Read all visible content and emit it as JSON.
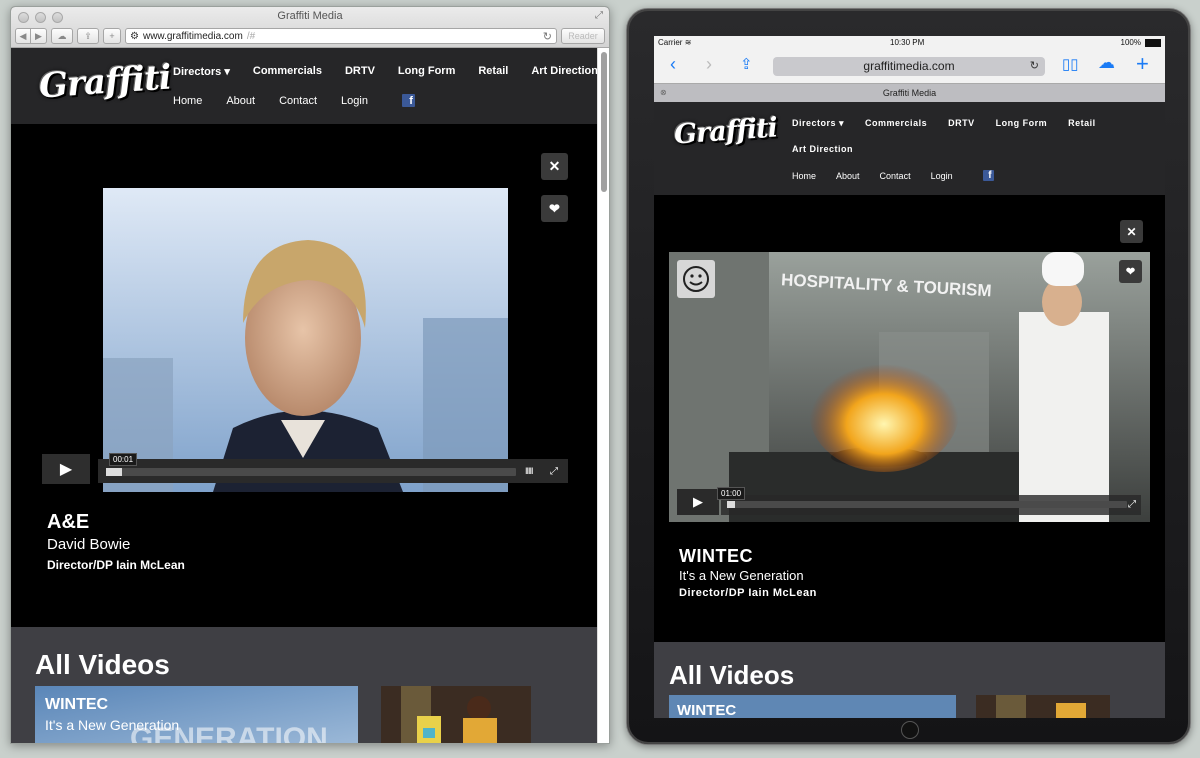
{
  "desktop": {
    "window_title": "Graffiti Media",
    "url": "www.graffitimedia.com",
    "url_hash": "/#",
    "reader_label": "Reader",
    "logo_text": "Graffiti",
    "nav_primary": [
      "Directors ▾",
      "Commercials",
      "DRTV",
      "Long Form",
      "Retail",
      "Art Direction"
    ],
    "nav_secondary": [
      "Home",
      "About",
      "Contact",
      "Login"
    ],
    "facebook_icon": "f",
    "close_icon": "✕",
    "heart_icon": "❤",
    "play_icon": "▶",
    "time_label": "00:01",
    "progress": 0.04,
    "volume_icon": "IIIII",
    "fullscreen_icon": "⤢",
    "caption": {
      "title": "A&E",
      "subtitle": "David Bowie",
      "director": "Director/DP Iain McLean"
    },
    "all_videos_heading": "All Videos",
    "thumbnails": [
      {
        "title": "WINTEC",
        "subtitle": "It's a New Generation"
      },
      {
        "title": "",
        "subtitle": ""
      }
    ]
  },
  "ipad": {
    "carrier": "Carrier",
    "time": "10:30 PM",
    "battery": "100%",
    "url": "graffitimedia.com",
    "tab_title": "Graffiti Media",
    "logo_text": "Graffiti",
    "nav_primary": [
      "Directors ▾",
      "Commercials",
      "DRTV",
      "Long Form",
      "Retail"
    ],
    "nav_primary_row2": [
      "Art Direction"
    ],
    "nav_secondary": [
      "Home",
      "About",
      "Contact",
      "Login"
    ],
    "facebook_icon": "f",
    "close_icon": "✕",
    "heart_icon": "❤",
    "play_icon": "▶",
    "time_label": "01:00",
    "progress": 0.02,
    "fullscreen_icon": "⤢",
    "video_overlay_text": "HOSPITALITY & TOURISM",
    "caption": {
      "title": "WINTEC",
      "subtitle": "It's a New Generation",
      "director": "Director/DP Iain McLean"
    },
    "all_videos_heading": "All Videos",
    "thumbnails": [
      {
        "title": "WINTEC"
      },
      {
        "title": ""
      }
    ]
  },
  "colors": {
    "nav_bg": "#262628",
    "section_bg": "#3f3f44",
    "ios_blue": "#1a7bf5",
    "facebook": "#3b5998"
  }
}
